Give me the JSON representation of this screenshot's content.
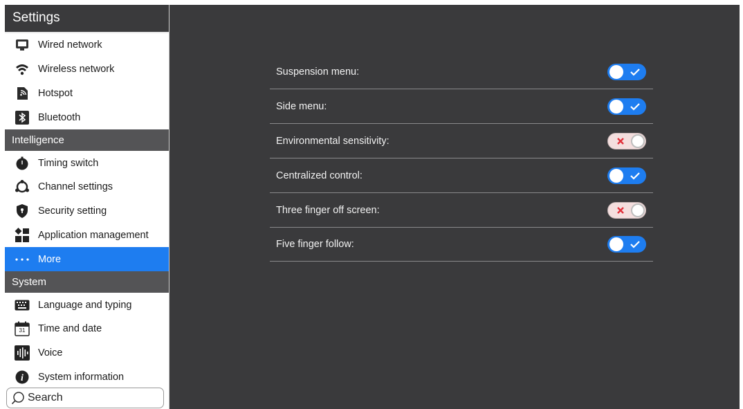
{
  "sidebar": {
    "title": "Settings",
    "network_items": [
      {
        "label": "Wired network",
        "icon": "monitor-icon"
      },
      {
        "label": "Wireless network",
        "icon": "wifi-icon"
      },
      {
        "label": "Hotspot",
        "icon": "hotspot-icon"
      },
      {
        "label": "Bluetooth",
        "icon": "bluetooth-icon"
      }
    ],
    "section_intelligence": "Intelligence",
    "intelligence_items": [
      {
        "label": "Timing switch",
        "icon": "timer-icon"
      },
      {
        "label": "Channel settings",
        "icon": "channel-icon"
      },
      {
        "label": "Security setting",
        "icon": "shield-icon"
      },
      {
        "label": "Application management",
        "icon": "apps-grid-icon"
      },
      {
        "label": "More",
        "icon": "more-dots-icon",
        "active": true
      }
    ],
    "section_system": "System",
    "system_items": [
      {
        "label": "Language and typing",
        "icon": "keyboard-icon"
      },
      {
        "label": "Time and date",
        "icon": "calendar-icon",
        "icon_text": "31"
      },
      {
        "label": "Voice",
        "icon": "voice-icon"
      },
      {
        "label": "System information",
        "icon": "info-icon"
      }
    ],
    "search_label": "Search"
  },
  "main": {
    "settings": [
      {
        "label": "Suspension menu:",
        "enabled": true
      },
      {
        "label": "Side menu:",
        "enabled": true
      },
      {
        "label": "Environmental sensitivity:",
        "enabled": false
      },
      {
        "label": "Centralized control:",
        "enabled": true
      },
      {
        "label": "Three finger off screen:",
        "enabled": false
      },
      {
        "label": "Five finger follow:",
        "enabled": true
      }
    ]
  },
  "colors": {
    "accent": "#1e7df0",
    "panel_bg": "#3a3a3c",
    "section_bg": "#545456",
    "toggle_off_bg": "#f4dede",
    "off_mark": "#e0303a"
  }
}
